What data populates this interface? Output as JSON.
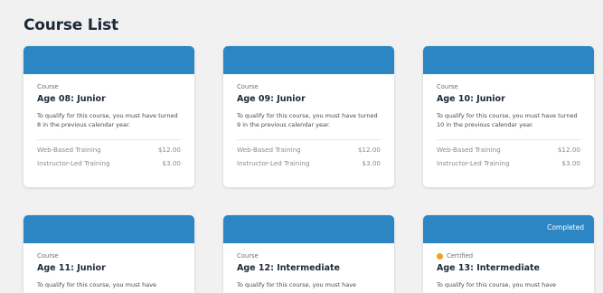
{
  "page": {
    "title": "Course List"
  },
  "courses": [
    {
      "type": "Course",
      "title": "Age 08: Junior",
      "description": "To qualify for this course, you must have turned 8 in the previous calendar year.",
      "prices": [
        {
          "label": "Web-Based Training",
          "amount": "$12.00"
        },
        {
          "label": "Instructor-Led Training",
          "amount": "$3.00"
        }
      ]
    },
    {
      "type": "Course",
      "title": "Age 09: Junior",
      "description": "To qualify for this course, you must have turned 9 in the previous calendar year.",
      "prices": [
        {
          "label": "Web-Based Training",
          "amount": "$12.00"
        },
        {
          "label": "Instructor-Led Training",
          "amount": "$3.00"
        }
      ]
    },
    {
      "type": "Course",
      "title": "Age 10: Junior",
      "description": "To qualify for this course, you must have turned 10 in the previous calendar year.",
      "prices": [
        {
          "label": "Web-Based Training",
          "amount": "$12.00"
        },
        {
          "label": "Instructor-Led Training",
          "amount": "$3.00"
        }
      ]
    },
    {
      "type": "Course",
      "title": "Age 11: Junior",
      "description": "To qualify for this course, you must have"
    },
    {
      "type": "Course",
      "title": "Age 12: Intermediate",
      "description": "To qualify for this course, you must have"
    },
    {
      "badge": "Completed",
      "type": "Certified",
      "type_icon": "certified-dot-icon",
      "title": "Age 13: Intermediate",
      "description": "To qualify for this course, you must have"
    }
  ],
  "colors": {
    "header": "#2d86c4",
    "certified": "#f0a21e",
    "background": "#f1f1f1"
  }
}
